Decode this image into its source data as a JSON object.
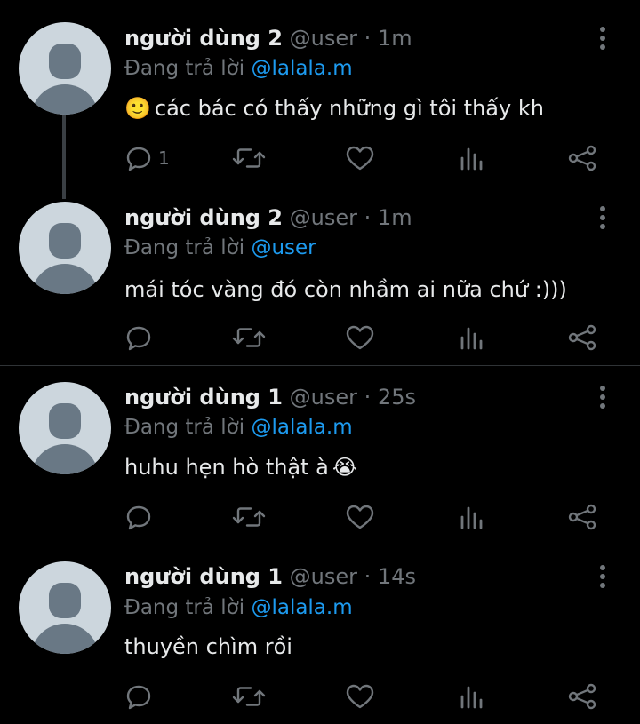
{
  "tweets": [
    {
      "name": "người dùng 2",
      "handle": "@user",
      "time": "1m",
      "reply_prefix": "Đang trả lời",
      "reply_to": "@lalala.m",
      "leading_emoji": "🙂",
      "text": "các bác có thấy những gì tôi thấy kh",
      "reply_count": "1"
    },
    {
      "name": "người dùng 2",
      "handle": "@user",
      "time": "1m",
      "reply_prefix": "Đang trả lời",
      "reply_to": "@user",
      "text": "mái tóc vàng đó còn nhầm ai nữa chứ :)))"
    },
    {
      "name": "người dùng 1",
      "handle": "@user",
      "time": "25s",
      "reply_prefix": "Đang trả lời",
      "reply_to": "@lalala.m",
      "text": "huhu hẹn hò thật à",
      "trailing_emoji": "😭"
    },
    {
      "name": "người dùng 1",
      "handle": "@user",
      "time": "14s",
      "reply_prefix": "Đang trả lời",
      "reply_to": "@lalala.m",
      "text": "thuyền chìm rồi"
    }
  ],
  "separator": "·",
  "icons": {
    "reply": "reply-icon",
    "retweet": "retweet-icon",
    "like": "like-icon",
    "views": "views-icon",
    "share": "share-icon",
    "more": "more-vertical-icon"
  },
  "colors": {
    "background": "#000000",
    "text": "#e7e9ea",
    "muted": "#71767b",
    "mention": "#1d9bf0",
    "divider": "#2f3336",
    "avatar_bg": "#ccd6dd",
    "avatar_fg": "#697885"
  }
}
